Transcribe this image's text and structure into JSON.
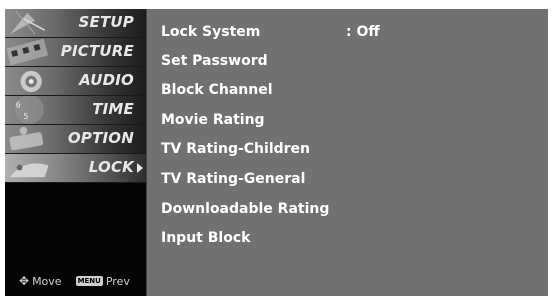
{
  "sidebar": {
    "items": [
      {
        "label": "SETUP",
        "icon": "satellite-dish-icon",
        "selected": false
      },
      {
        "label": "PICTURE",
        "icon": "film-reel-icon",
        "selected": false
      },
      {
        "label": "AUDIO",
        "icon": "speaker-icon",
        "selected": false
      },
      {
        "label": "TIME",
        "icon": "clock-icon",
        "selected": false
      },
      {
        "label": "OPTION",
        "icon": "option-tag-icon",
        "selected": false
      },
      {
        "label": "LOCK",
        "icon": "lock-icon",
        "selected": true
      }
    ]
  },
  "hints": {
    "move_label": "Move",
    "menu_key": "MENU",
    "prev_label": "Prev"
  },
  "options": [
    {
      "label": "Lock System",
      "value": ": Off"
    },
    {
      "label": "Set Password"
    },
    {
      "label": "Block Channel"
    },
    {
      "label": "Movie Rating"
    },
    {
      "label": "TV Rating-Children"
    },
    {
      "label": "TV Rating-General"
    },
    {
      "label": "Downloadable Rating"
    },
    {
      "label": "Input Block"
    }
  ]
}
